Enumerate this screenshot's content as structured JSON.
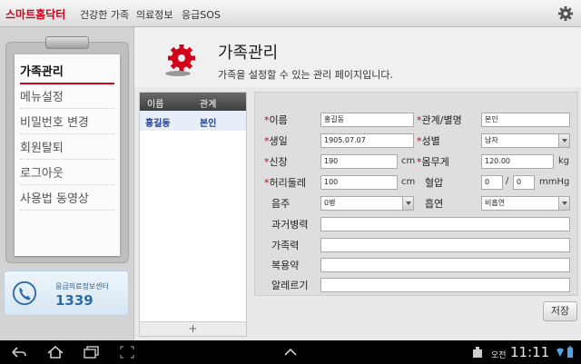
{
  "topbar": {
    "brand": "스마트홈닥터",
    "nav": [
      "건강한 가족",
      "의료정보",
      "응급SOS"
    ],
    "icon": "gear-icon"
  },
  "sidebar": {
    "items": [
      {
        "label": "가족관리",
        "active": true
      },
      {
        "label": "메뉴설정"
      },
      {
        "label": "비밀번호 변경"
      },
      {
        "label": "회원탈퇴"
      },
      {
        "label": "로그아웃"
      },
      {
        "label": "사용법 동영상"
      }
    ],
    "hotline": {
      "label": "응급의료정보센터",
      "number": "1339"
    }
  },
  "header": {
    "title": "가족관리",
    "subtitle": "가족을 설정할 수 있는 관리 페이지입니다."
  },
  "members": {
    "columns": [
      "이름",
      "관계"
    ],
    "rows": [
      {
        "name": "홍길동",
        "relation": "본인"
      }
    ],
    "add_label": "+"
  },
  "form": {
    "name": {
      "label": "이름",
      "value": "홍길동"
    },
    "relation": {
      "label": "관계/별명",
      "value": "본인"
    },
    "birth": {
      "label": "생일",
      "value": "1905.07.07"
    },
    "gender": {
      "label": "성별",
      "value": "남자"
    },
    "height": {
      "label": "신장",
      "value": "190",
      "unit": "cm"
    },
    "weight": {
      "label": "몸무게",
      "value": "120.00",
      "unit": "kg"
    },
    "waist": {
      "label": "허리둘레",
      "value": "100",
      "unit": "cm"
    },
    "bp": {
      "label": "혈압",
      "value1": "0",
      "separator": "/",
      "value2": "0",
      "unit": "mmHg"
    },
    "drinking": {
      "label": "음주",
      "value": "0병"
    },
    "smoking": {
      "label": "흡연",
      "value": "비흡연"
    },
    "history": {
      "label": "과거병력",
      "value": ""
    },
    "family": {
      "label": "가족력",
      "value": ""
    },
    "medication": {
      "label": "복용약",
      "value": ""
    },
    "allergy": {
      "label": "알레르기",
      "value": ""
    }
  },
  "save_label": "저장",
  "statusbar": {
    "ampm": "오전",
    "time": "11:11"
  },
  "colors": {
    "brand": "#d0021b",
    "member_text": "#1e3f9c",
    "hotline": "#2b6ca8"
  }
}
